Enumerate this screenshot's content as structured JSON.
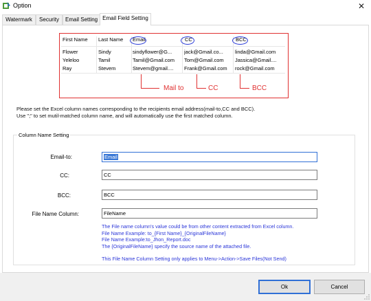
{
  "window": {
    "title": "Option",
    "close_glyph": "✕"
  },
  "tabs": [
    {
      "label": "Watermark"
    },
    {
      "label": "Security"
    },
    {
      "label": "Email Setting"
    },
    {
      "label": "Email Field Setting",
      "active": true
    }
  ],
  "example": {
    "headers": [
      "First Name",
      "Last Name",
      "Email",
      "CC",
      "BCC"
    ],
    "rows": [
      [
        "Flower",
        "Sindy",
        "sindyflower@G...",
        "jack@Gmail.co...",
        "linda@Gmail.com"
      ],
      [
        "Yeleloo",
        "Tamil",
        "Tamil@Gmail.com",
        "Tom@Gmail.com",
        "Jassica@Gmail...."
      ],
      [
        "Ray",
        "Stevem",
        "Stevem@gmail....",
        "Frank@Gmail.com",
        "rock@Gmail.com"
      ]
    ],
    "annotations": {
      "mail_to": "Mail to",
      "cc": "CC",
      "bcc": "BCC"
    }
  },
  "instructions": {
    "line1": "Please set the Excel column names corresponding to the recipients email address(mail-to,CC and BCC).",
    "line2": "Use \";\" to set mutil-matched column name, and will automatically use the first matched column."
  },
  "column_setting": {
    "legend": "Column Name Setting",
    "email_to": {
      "label": "Email-to:",
      "value": "Email"
    },
    "cc": {
      "label": "CC:",
      "value": "CC"
    },
    "bcc": {
      "label": "BCC:",
      "value": "BCC"
    },
    "file_name": {
      "label": "File Name Column:",
      "value": "FileName"
    }
  },
  "help": {
    "line1": "The File name column's value could be from other content extracted from Excel column.",
    "line2": "File Name Example: to_{First Name}_{OriginalFileName}",
    "line3": "File Name Example:to_Jhon_Report.doc",
    "line4": "The {OriginalFileName} specify the source name of the attached file.",
    "line5": "This File Name Column Setting only applies to Menu->Action->Save Files(Not Send)"
  },
  "buttons": {
    "ok": "Ok",
    "cancel": "Cancel"
  },
  "colors": {
    "annotation_red": "#e03030",
    "highlight_blue": "#2a3bd8",
    "selection": "#3a78d6"
  }
}
